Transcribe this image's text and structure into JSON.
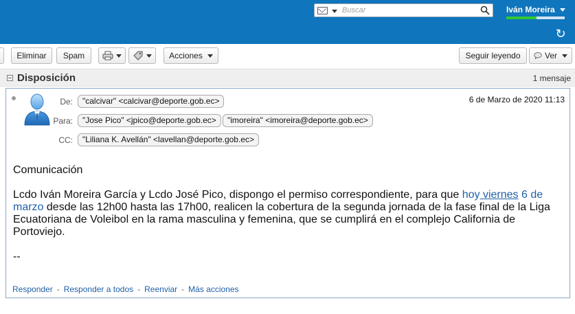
{
  "header": {
    "search_placeholder": "Buscar",
    "user_name": "Iván Moreira",
    "quota_fraction": 0.52,
    "colors": {
      "bar": "#0f75bc",
      "quota": "#32c832"
    }
  },
  "toolbar": {
    "delete_label": "Eliminar",
    "spam_label": "Spam",
    "actions_label": "Acciones",
    "continue_label": "Seguir leyendo",
    "view_label": "Ver"
  },
  "conversation": {
    "title": "Disposición",
    "count": "1 mensaje"
  },
  "message": {
    "from_label": "De:",
    "to_label": "Para:",
    "cc_label": "CC:",
    "from": "\"calcivar\" <calcivar@deporte.gob.ec>",
    "to": [
      "\"Jose Pico\" <jpico@deporte.gob.ec>",
      "\"imoreira\" <imoreira@deporte.gob.ec>"
    ],
    "cc": "\"Liliana K. Avellán\" <lavellan@deporte.gob.ec>",
    "date": "6 de Marzo de 2020 11:13",
    "body": {
      "greeting": "Comunicación",
      "p_start": "Lcdo Iván Moreira García y  Lcdo José Pico, dispongo el permiso correspondiente, para que ",
      "link_hoy": "hoy",
      "link_viernes": " viernes",
      "link_date": "6 de marzo",
      "p_end": " desde las 12h00 hasta las 17h00,  realicen  la cobertura de la segunda jornada de la fase final de la Liga Ecuatoriana de Voleibol en la rama masculina y femenina, que se cumplirá en el complejo California de Portoviejo.",
      "signature": "--"
    },
    "actions": {
      "reply": "Responder",
      "reply_all": "Responder a todos",
      "forward": "Reenviar",
      "more": "Más acciones",
      "separator": "-"
    }
  }
}
